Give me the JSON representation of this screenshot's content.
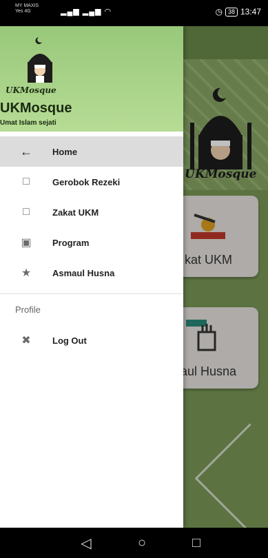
{
  "status_bar": {
    "carrier_line1": "MY MAXIS",
    "carrier_line2": "Yes 4G",
    "signal_icons": "▂▄▆ ▂▄▆ ◠",
    "battery": "38",
    "time": "13:47"
  },
  "background_app": {
    "logo_text": "UKMosque",
    "card1_label": "kat UKM",
    "card2_label": "aul Husna"
  },
  "drawer": {
    "header": {
      "logo_script": "UKMosque",
      "title": "UKMosque",
      "subtitle": "Umat Islam sejati"
    },
    "items": [
      {
        "label": "Home",
        "icon": "arrow-back-icon",
        "glyph": "←"
      },
      {
        "label": "Gerobok Rezeki",
        "icon": "page-icon",
        "glyph": "□"
      },
      {
        "label": "Zakat UKM",
        "icon": "page-icon",
        "glyph": "□"
      },
      {
        "label": "Program",
        "icon": "program-icon",
        "glyph": "▣"
      },
      {
        "label": "Asmaul Husna",
        "icon": "star-icon",
        "glyph": "★"
      }
    ],
    "section_title": "Profile",
    "logout": {
      "label": "Log Out",
      "icon": "close-icon",
      "glyph": "✖"
    }
  },
  "nav_bar": {
    "back": "◁",
    "home": "○",
    "recents": "□"
  },
  "colors": {
    "drawer_header_top": "#98c87a",
    "drawer_header_bottom": "#b7dc95",
    "active_item": "#dcdcdc",
    "app_background": "#7b9a57"
  }
}
